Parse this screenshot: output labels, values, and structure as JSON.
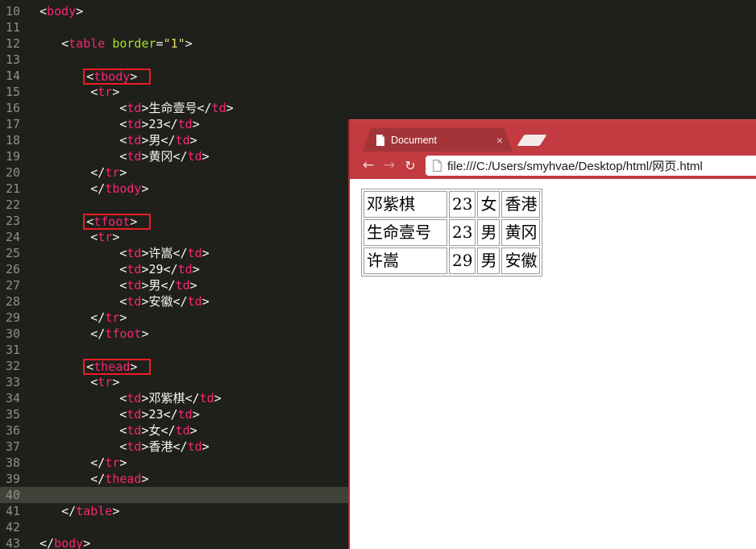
{
  "colors": {
    "editor_bg": "#1f201b",
    "gutter_fg": "#8f9086",
    "code_fg": "#f8f8f2",
    "tag_pink": "#f92672",
    "attr_green": "#a6e22e",
    "string_yellow": "#e6db74",
    "annotation_box_red": "#ed1c24",
    "line_highlight": "#41423a",
    "chrome_red": "#c13b41",
    "tab_red": "#a33539"
  },
  "editor": {
    "lines": [
      {
        "n": "10",
        "ind": 1,
        "tok": [
          [
            "<",
            "p"
          ],
          [
            "body",
            "t"
          ],
          [
            ">",
            "p"
          ]
        ]
      },
      {
        "n": "11",
        "ind": 0,
        "tok": []
      },
      {
        "n": "12",
        "ind": 4,
        "tok": [
          [
            "<",
            "p"
          ],
          [
            "table",
            "t"
          ],
          [
            " ",
            "p"
          ],
          [
            "border",
            "a"
          ],
          [
            "=",
            "p"
          ],
          [
            "\"1\"",
            "s"
          ],
          [
            ">",
            "p"
          ]
        ]
      },
      {
        "n": "13",
        "ind": 0,
        "tok": []
      },
      {
        "n": "14",
        "ind": 7,
        "box": true,
        "tok": [
          [
            "<",
            "p"
          ],
          [
            "tbody",
            "t"
          ],
          [
            ">",
            "p"
          ]
        ]
      },
      {
        "n": "15",
        "ind": 8,
        "tok": [
          [
            "<",
            "p"
          ],
          [
            "tr",
            "t"
          ],
          [
            ">",
            "p"
          ]
        ]
      },
      {
        "n": "16",
        "ind": 12,
        "tok": [
          [
            "<",
            "p"
          ],
          [
            "td",
            "t"
          ],
          [
            ">",
            "p"
          ],
          [
            "生命壹号",
            "w"
          ],
          [
            "</",
            "p"
          ],
          [
            "td",
            "t"
          ],
          [
            ">",
            "p"
          ]
        ]
      },
      {
        "n": "17",
        "ind": 12,
        "tok": [
          [
            "<",
            "p"
          ],
          [
            "td",
            "t"
          ],
          [
            ">",
            "p"
          ],
          [
            "23",
            "w"
          ],
          [
            "</",
            "p"
          ],
          [
            "td",
            "t"
          ],
          [
            ">",
            "p"
          ]
        ]
      },
      {
        "n": "18",
        "ind": 12,
        "tok": [
          [
            "<",
            "p"
          ],
          [
            "td",
            "t"
          ],
          [
            ">",
            "p"
          ],
          [
            "男",
            "w"
          ],
          [
            "</",
            "p"
          ],
          [
            "td",
            "t"
          ],
          [
            ">",
            "p"
          ]
        ]
      },
      {
        "n": "19",
        "ind": 12,
        "tok": [
          [
            "<",
            "p"
          ],
          [
            "td",
            "t"
          ],
          [
            ">",
            "p"
          ],
          [
            "黄冈",
            "w"
          ],
          [
            "</",
            "p"
          ],
          [
            "td",
            "t"
          ],
          [
            ">",
            "p"
          ]
        ]
      },
      {
        "n": "20",
        "ind": 8,
        "tok": [
          [
            "</",
            "p"
          ],
          [
            "tr",
            "t"
          ],
          [
            ">",
            "p"
          ]
        ]
      },
      {
        "n": "21",
        "ind": 8,
        "tok": [
          [
            "</",
            "p"
          ],
          [
            "tbody",
            "t"
          ],
          [
            ">",
            "p"
          ]
        ]
      },
      {
        "n": "22",
        "ind": 0,
        "tok": []
      },
      {
        "n": "23",
        "ind": 7,
        "box": true,
        "tok": [
          [
            "<",
            "p"
          ],
          [
            "tfoot",
            "t"
          ],
          [
            ">",
            "p"
          ]
        ]
      },
      {
        "n": "24",
        "ind": 8,
        "tok": [
          [
            "<",
            "p"
          ],
          [
            "tr",
            "t"
          ],
          [
            ">",
            "p"
          ]
        ]
      },
      {
        "n": "25",
        "ind": 12,
        "tok": [
          [
            "<",
            "p"
          ],
          [
            "td",
            "t"
          ],
          [
            ">",
            "p"
          ],
          [
            "许嵩",
            "w"
          ],
          [
            "</",
            "p"
          ],
          [
            "td",
            "t"
          ],
          [
            ">",
            "p"
          ]
        ]
      },
      {
        "n": "26",
        "ind": 12,
        "tok": [
          [
            "<",
            "p"
          ],
          [
            "td",
            "t"
          ],
          [
            ">",
            "p"
          ],
          [
            "29",
            "w"
          ],
          [
            "</",
            "p"
          ],
          [
            "td",
            "t"
          ],
          [
            ">",
            "p"
          ]
        ]
      },
      {
        "n": "27",
        "ind": 12,
        "tok": [
          [
            "<",
            "p"
          ],
          [
            "td",
            "t"
          ],
          [
            ">",
            "p"
          ],
          [
            "男",
            "w"
          ],
          [
            "</",
            "p"
          ],
          [
            "td",
            "t"
          ],
          [
            ">",
            "p"
          ]
        ]
      },
      {
        "n": "28",
        "ind": 12,
        "tok": [
          [
            "<",
            "p"
          ],
          [
            "td",
            "t"
          ],
          [
            ">",
            "p"
          ],
          [
            "安徽",
            "w"
          ],
          [
            "</",
            "p"
          ],
          [
            "td",
            "t"
          ],
          [
            ">",
            "p"
          ]
        ]
      },
      {
        "n": "29",
        "ind": 8,
        "tok": [
          [
            "</",
            "p"
          ],
          [
            "tr",
            "t"
          ],
          [
            ">",
            "p"
          ]
        ]
      },
      {
        "n": "30",
        "ind": 8,
        "tok": [
          [
            "</",
            "p"
          ],
          [
            "tfoot",
            "t"
          ],
          [
            ">",
            "p"
          ]
        ]
      },
      {
        "n": "31",
        "ind": 0,
        "tok": []
      },
      {
        "n": "32",
        "ind": 7,
        "box": true,
        "tok": [
          [
            "<",
            "p"
          ],
          [
            "thead",
            "t"
          ],
          [
            ">",
            "p"
          ]
        ]
      },
      {
        "n": "33",
        "ind": 8,
        "tok": [
          [
            "<",
            "p"
          ],
          [
            "tr",
            "t"
          ],
          [
            ">",
            "p"
          ]
        ]
      },
      {
        "n": "34",
        "ind": 12,
        "tok": [
          [
            "<",
            "p"
          ],
          [
            "td",
            "t"
          ],
          [
            ">",
            "p"
          ],
          [
            "邓紫棋",
            "w"
          ],
          [
            "</",
            "p"
          ],
          [
            "td",
            "t"
          ],
          [
            ">",
            "p"
          ]
        ]
      },
      {
        "n": "35",
        "ind": 12,
        "tok": [
          [
            "<",
            "p"
          ],
          [
            "td",
            "t"
          ],
          [
            ">",
            "p"
          ],
          [
            "23",
            "w"
          ],
          [
            "</",
            "p"
          ],
          [
            "td",
            "t"
          ],
          [
            ">",
            "p"
          ]
        ]
      },
      {
        "n": "36",
        "ind": 12,
        "tok": [
          [
            "<",
            "p"
          ],
          [
            "td",
            "t"
          ],
          [
            ">",
            "p"
          ],
          [
            "女",
            "w"
          ],
          [
            "</",
            "p"
          ],
          [
            "td",
            "t"
          ],
          [
            ">",
            "p"
          ]
        ]
      },
      {
        "n": "37",
        "ind": 12,
        "tok": [
          [
            "<",
            "p"
          ],
          [
            "td",
            "t"
          ],
          [
            ">",
            "p"
          ],
          [
            "香港",
            "w"
          ],
          [
            "</",
            "p"
          ],
          [
            "td",
            "t"
          ],
          [
            ">",
            "p"
          ]
        ]
      },
      {
        "n": "38",
        "ind": 8,
        "tok": [
          [
            "</",
            "p"
          ],
          [
            "tr",
            "t"
          ],
          [
            ">",
            "p"
          ]
        ]
      },
      {
        "n": "39",
        "ind": 8,
        "tok": [
          [
            "</",
            "p"
          ],
          [
            "thead",
            "t"
          ],
          [
            ">",
            "p"
          ]
        ]
      },
      {
        "n": "40",
        "ind": 0,
        "hl": true,
        "tok": []
      },
      {
        "n": "41",
        "ind": 4,
        "tok": [
          [
            "</",
            "p"
          ],
          [
            "table",
            "t"
          ],
          [
            ">",
            "p"
          ]
        ]
      },
      {
        "n": "42",
        "ind": 0,
        "tok": []
      },
      {
        "n": "43",
        "ind": 1,
        "tok": [
          [
            "</",
            "p"
          ],
          [
            "body",
            "t"
          ],
          [
            ">",
            "p"
          ]
        ]
      }
    ]
  },
  "browser": {
    "tab_title": "Document",
    "close_glyph": "×",
    "nav": {
      "back": "←",
      "forward": "→",
      "refresh": "↻"
    },
    "url": "file:///C:/Users/smyhvae/Desktop/html/网页.html",
    "table_rows": [
      [
        "邓紫棋",
        "23",
        "女",
        "香港"
      ],
      [
        "生命壹号",
        "23",
        "男",
        "黄冈"
      ],
      [
        "许嵩",
        "29",
        "男",
        "安徽"
      ]
    ]
  }
}
